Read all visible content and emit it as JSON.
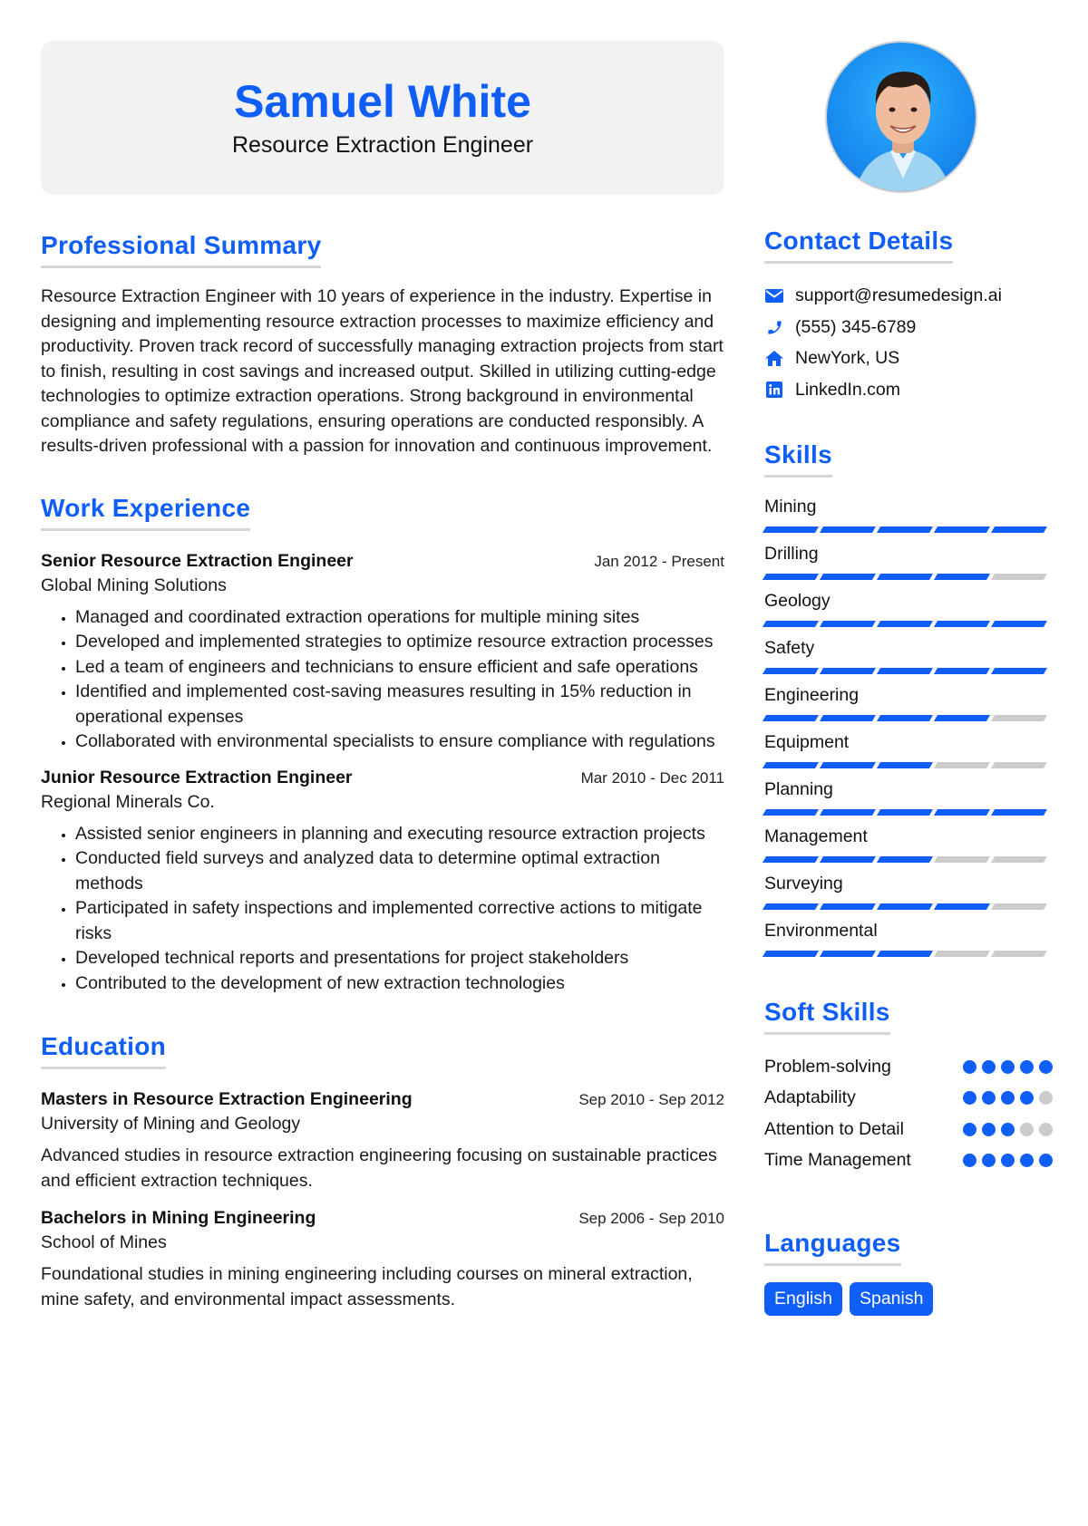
{
  "header": {
    "name": "Samuel White",
    "title": "Resource Extraction Engineer"
  },
  "photo": {
    "alt": "Profile photo of Samuel White"
  },
  "summary": {
    "heading": "Professional Summary",
    "text": "Resource Extraction Engineer with 10 years of experience in the industry. Expertise in designing and implementing resource extraction processes to maximize efficiency and productivity. Proven track record of successfully managing extraction projects from start to finish, resulting in cost savings and increased output. Skilled in utilizing cutting-edge technologies to optimize extraction operations. Strong background in environmental compliance and safety regulations, ensuring operations are conducted responsibly. A results-driven professional with a passion for innovation and continuous improvement."
  },
  "experience": {
    "heading": "Work Experience",
    "jobs": [
      {
        "role": "Senior Resource Extraction Engineer",
        "dates": "Jan 2012 - Present",
        "company": "Global Mining Solutions",
        "bullets": [
          "Managed and coordinated extraction operations for multiple mining sites",
          "Developed and implemented strategies to optimize resource extraction processes",
          "Led a team of engineers and technicians to ensure efficient and safe operations",
          "Identified and implemented cost-saving measures resulting in 15% reduction in operational expenses",
          "Collaborated with environmental specialists to ensure compliance with regulations"
        ]
      },
      {
        "role": "Junior Resource Extraction Engineer",
        "dates": "Mar 2010 - Dec 2011",
        "company": "Regional Minerals Co.",
        "bullets": [
          "Assisted senior engineers in planning and executing resource extraction projects",
          "Conducted field surveys and analyzed data to determine optimal extraction methods",
          "Participated in safety inspections and implemented corrective actions to mitigate risks",
          "Developed technical reports and presentations for project stakeholders",
          "Contributed to the development of new extraction technologies"
        ]
      }
    ]
  },
  "education": {
    "heading": "Education",
    "items": [
      {
        "degree": "Masters in Resource Extraction Engineering",
        "dates": "Sep 2010 - Sep 2012",
        "school": "University of Mining and Geology",
        "description": "Advanced studies in resource extraction engineering focusing on sustainable practices and efficient extraction techniques."
      },
      {
        "degree": "Bachelors in Mining Engineering",
        "dates": "Sep 2006 - Sep 2010",
        "school": "School of Mines",
        "description": "Foundational studies in mining engineering including courses on mineral extraction, mine safety, and environmental impact assessments."
      }
    ]
  },
  "contact": {
    "heading": "Contact Details",
    "items": [
      {
        "icon": "envelope-icon",
        "text": "support@resumedesign.ai"
      },
      {
        "icon": "phone-icon",
        "text": "(555) 345-6789"
      },
      {
        "icon": "home-icon",
        "text": "NewYork, US"
      },
      {
        "icon": "linkedin-icon",
        "text": "LinkedIn.com"
      }
    ]
  },
  "skills": {
    "heading": "Skills",
    "max": 5,
    "items": [
      {
        "name": "Mining",
        "level": 5
      },
      {
        "name": "Drilling",
        "level": 4
      },
      {
        "name": "Geology",
        "level": 5
      },
      {
        "name": "Safety",
        "level": 5
      },
      {
        "name": "Engineering",
        "level": 4
      },
      {
        "name": "Equipment",
        "level": 3
      },
      {
        "name": "Planning",
        "level": 5
      },
      {
        "name": "Management",
        "level": 3
      },
      {
        "name": "Surveying",
        "level": 4
      },
      {
        "name": "Environmental",
        "level": 3
      }
    ]
  },
  "soft_skills": {
    "heading": "Soft Skills",
    "max": 5,
    "items": [
      {
        "name": "Problem-solving",
        "level": 5
      },
      {
        "name": "Adaptability",
        "level": 4
      },
      {
        "name": "Attention to Detail",
        "level": 3
      },
      {
        "name": "Time Management",
        "level": 5
      }
    ]
  },
  "languages": {
    "heading": "Languages",
    "items": [
      "English",
      "Spanish"
    ]
  },
  "colors": {
    "accent": "#0f5ef7",
    "inactive": "#cbcbcb",
    "header_bg": "#f2f2f2"
  }
}
